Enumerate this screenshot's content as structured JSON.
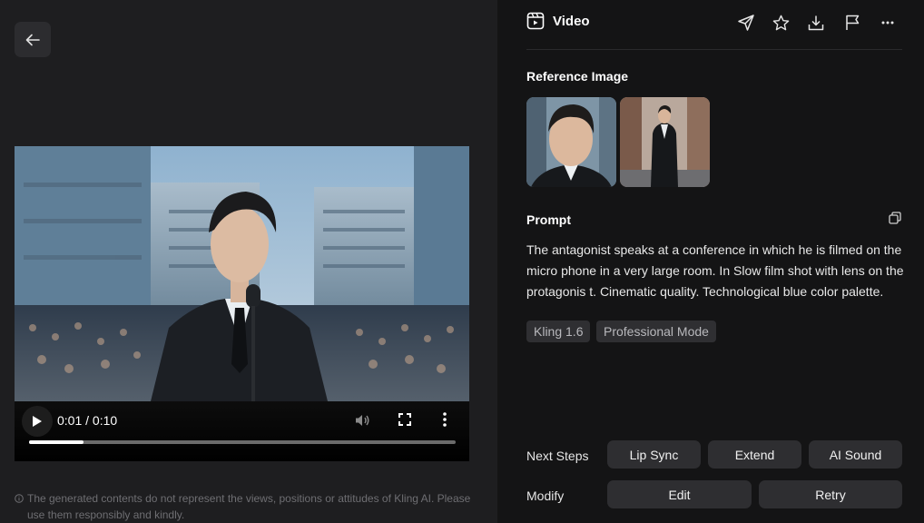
{
  "player": {
    "time": "0:01 / 0:10",
    "progress_fraction": 0.128
  },
  "disclaimer": "The generated contents do not represent the views, positions or attitudes of Kling AI. Please use them responsibly and kindly.",
  "panel": {
    "title": "Video",
    "reference_title": "Reference Image",
    "prompt_title": "Prompt",
    "prompt_text": "The antagonist speaks at a conference in which he is filmed on the micro phone in a very large room. In Slow film shot with lens on the protagonis t. Cinematic quality. Technological blue color palette.",
    "tags": [
      "Kling 1.6",
      "Professional Mode"
    ],
    "next_steps_label": "Next Steps",
    "next_steps": [
      "Lip Sync",
      "Extend",
      "AI Sound"
    ],
    "modify_label": "Modify",
    "modify": [
      "Edit",
      "Retry"
    ]
  },
  "icons": [
    "back-arrow-icon",
    "play-icon",
    "volume-icon",
    "fullscreen-icon",
    "more-vertical-icon",
    "info-icon",
    "video-icon",
    "send-icon",
    "star-icon",
    "download-icon",
    "flag-icon",
    "more-horizontal-icon",
    "copy-icon"
  ]
}
